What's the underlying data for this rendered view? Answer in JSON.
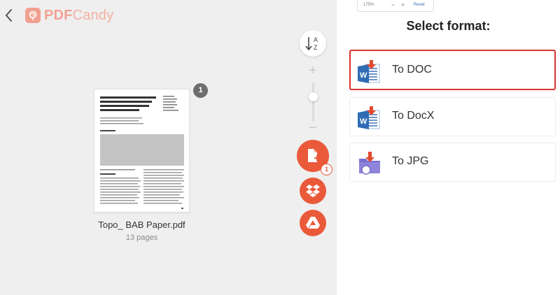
{
  "app": {
    "logo_text": "PDF",
    "logo_text_light": "Candy"
  },
  "sidebar_tools": {
    "zoom_plus": "+",
    "zoom_minus": "−",
    "add_badge_count": "1"
  },
  "file": {
    "name": "Topo_ BAB Paper.pdf",
    "pages_label": "13 pages",
    "page_number": "1"
  },
  "zoom_panel": {
    "percent": "175%",
    "minus": "−",
    "plus": "+",
    "reset": "Reset"
  },
  "format_panel": {
    "title": "Select format:",
    "options": [
      {
        "label": "To DOC",
        "selected": true
      },
      {
        "label": "To DocX",
        "selected": false
      },
      {
        "label": "To JPG",
        "selected": false
      }
    ]
  },
  "colors": {
    "accent": "#ea5a3a",
    "selected_border": "#d9332d",
    "word_blue": "#2f6db5",
    "jpg_purple": "#7a6fd0"
  },
  "icons": [
    "chevron-left-icon",
    "pdfcandy-logo-icon",
    "sort-az-icon",
    "add-file-icon",
    "dropbox-icon",
    "google-drive-icon",
    "word-doc-icon",
    "jpg-image-icon"
  ]
}
